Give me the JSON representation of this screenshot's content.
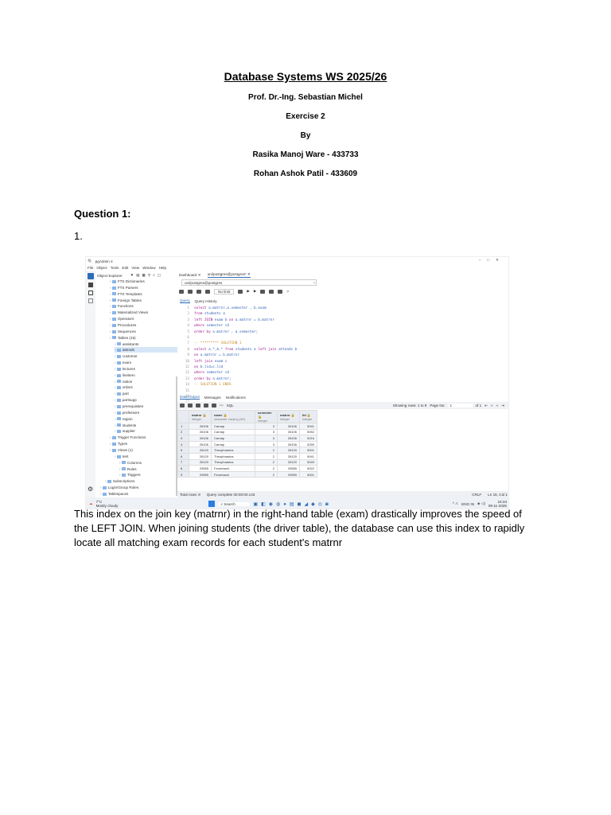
{
  "doc": {
    "title": "Database Systems WS 2025/26",
    "professor": "Prof. Dr.-Ing. Sebastian Michel",
    "exercise": "Exercise 2",
    "by": "By",
    "author1": "Rasika Manoj Ware - 433733",
    "author2": "Rohan Ashok Patil - 433609",
    "question": "Question 1:",
    "item": "1.",
    "answer": "This index on the join key (matrnr) in the right-hand table (exam) drastically improves the speed of the LEFT JOIN. When joining students (the driver table), the database can use this index to rapidly locate all matching exam records for each student's matrnr"
  },
  "app": {
    "title": "pgAdmin 4",
    "menu": [
      "File",
      "Object",
      "Tools",
      "Edit",
      "View",
      "Window",
      "Help"
    ],
    "explorer": "Object Explorer",
    "tree": [
      "FTS Dictionaries",
      "FTS Parsers",
      "FTS Templates",
      "Foreign Tables",
      "Functions",
      "Materialized Views",
      "Operators",
      "Procedures",
      "Sequences",
      "Tables (15)",
      "assistants",
      "attends",
      "customer",
      "exam",
      "lectures",
      "lineitem",
      "nation",
      "orders",
      "part",
      "partsupp",
      "prerequisites",
      "professors",
      "region",
      "students",
      "supplier",
      "Trigger Functions",
      "Types",
      "Views (1)",
      "test",
      "Columns",
      "Rules",
      "Triggers",
      "Subscriptions",
      "Login/Group Roles",
      "Tablespaces"
    ],
    "tabs": [
      "Dashboard",
      "uni/postgres@postgres*"
    ],
    "connection": "uni/postgres@postgres",
    "nolimit": "No limit",
    "qtabs": [
      "Query",
      "Query History"
    ],
    "code": [
      [
        "kw",
        "select "
      ],
      [
        "id",
        "a.matrnr,a.semester , b.exam"
      ],
      [
        "kw",
        "from "
      ],
      [
        "id",
        "students a"
      ],
      [
        "kw",
        "left JOIN "
      ],
      [
        "id",
        "exam b on a.matrnr = b.matrnr"
      ],
      [
        "kw",
        "where "
      ],
      [
        "id",
        "semester <4"
      ],
      [
        "kw",
        "order by "
      ],
      [
        "id",
        "a.matrnr , a.semester;"
      ]
    ],
    "lines": [
      "select a.matrnr,a.semester , b.exam",
      "from students a",
      "left JOIN exam b on a.matrnr = b.matrnr",
      "where semester <4",
      "order by a.matrnr , a.semester;",
      "",
      "-- ********* SOLUTION 1",
      "select a.*,b.* from students a left join attends b",
      "on a.matrnr = b.matrnr",
      "left join exam c",
      "on b.lid=c.lid",
      "where semester <4",
      "order by a.matrnr;",
      "-- SOLUTION 1 ENDS",
      "",
      "",
      ""
    ],
    "otabs": [
      "Data Output",
      "Messages",
      "Notifications"
    ],
    "sql": "SQL",
    "showing": "Showing rows: 1 to 9",
    "pageno": "Page No:",
    "page": "1",
    "of": "of 1",
    "columns": [
      [
        "matrnr",
        "integer"
      ],
      [
        "name",
        "character varying (30)"
      ],
      [
        "semester",
        "integer"
      ],
      [
        "matrnr",
        "integer"
      ],
      [
        "lid",
        "integer"
      ]
    ],
    "rows": [
      [
        "1",
        "26106",
        "Carnap",
        "3",
        "26106",
        "5041"
      ],
      [
        "2",
        "26106",
        "Carnap",
        "3",
        "26106",
        "5052"
      ],
      [
        "3",
        "26106",
        "Carnap",
        "3",
        "26106",
        "5216"
      ],
      [
        "4",
        "26106",
        "Carnap",
        "3",
        "26106",
        "5259"
      ],
      [
        "5",
        "26120",
        "Theophrastos",
        "2",
        "26120",
        "5001"
      ],
      [
        "6",
        "26120",
        "Theophrastos",
        "2",
        "26120",
        "5041"
      ],
      [
        "7",
        "26120",
        "Theophrastos",
        "2",
        "26120",
        "5049"
      ],
      [
        "8",
        "29555",
        "Feuerbach",
        "2",
        "29555",
        "5022"
      ],
      [
        "9",
        "29555",
        "Feuerbach",
        "2",
        "29555",
        "5001"
      ]
    ],
    "total": "Total rows: 9",
    "complete": "Query complete 00:00:00.143",
    "crlf": "CRLF",
    "pos": "Ln 15, Col 1",
    "weather_temp": "7°C",
    "weather": "Mostly cloudy",
    "search": "Search",
    "lang": "ENG IN",
    "time": "16:34",
    "date": "09-11-2025"
  }
}
